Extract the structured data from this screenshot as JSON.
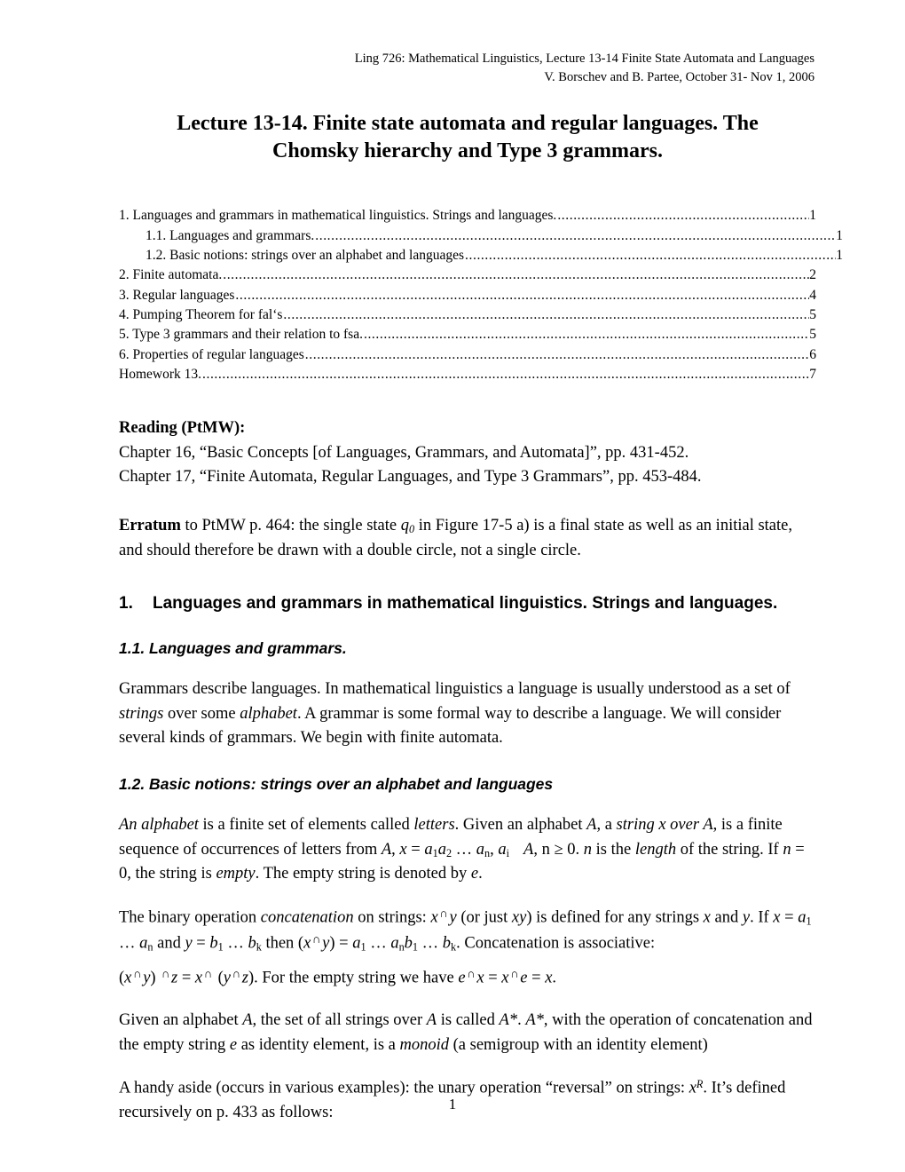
{
  "running_header": {
    "line1": "Ling 726: Mathematical Linguistics, Lecture 13-14 Finite State Automata and Languages",
    "line2": "V. Borschev and B. Partee, October 31- Nov 1, 2006"
  },
  "doc_title": {
    "line1": "Lecture 13-14. Finite state automata and regular languages. The Chomsky",
    "line2": "hierarchy and Type 3 grammars."
  },
  "toc": {
    "entries": [
      {
        "level": 1,
        "label": "1.  Languages and grammars in mathematical linguistics. Strings and languages.",
        "page": "1"
      },
      {
        "level": 2,
        "label": "1.1. Languages and grammars.",
        "page": "1"
      },
      {
        "level": 2,
        "label": "1.2. Basic notions: strings over an alphabet and languages",
        "page": "1"
      },
      {
        "level": 1,
        "label": "2.  Finite automata.",
        "page": "2"
      },
      {
        "level": 1,
        "label": "3.  Regular languages",
        "page": "4"
      },
      {
        "level": 1,
        "label": "4. Pumping Theorem for fal‘s",
        "page": "5"
      },
      {
        "level": 1,
        "label": "5.  Type 3 grammars and their relation to fsa.",
        "page": "5"
      },
      {
        "level": 1,
        "label": "6. Properties of regular languages",
        "page": "6"
      },
      {
        "level": 1,
        "label": "Homework 13.",
        "page": "7"
      }
    ]
  },
  "reading": {
    "heading": "Reading (PtMW):",
    "chapter16": "Chapter 16, “Basic Concepts [of Languages, Grammars, and Automata]”, pp. 431-452.",
    "chapter17": "Chapter 17, “Finite Automata, Regular Languages, and Type 3 Grammars”, pp. 453-484."
  },
  "erratum": {
    "lead": "Erratum",
    "text_before_q": " to PtMW p. 464: the single state ",
    "state_symbol": "q",
    "state_subscript": "0",
    "text_after_q": " in Figure 17-5 a) is a final state as well as an initial state, and should therefore be drawn with a double circle, not a single circle."
  },
  "section1": {
    "number": "1.",
    "heading": "Languages and grammars in mathematical linguistics. Strings and languages.",
    "sub1": {
      "heading": "1.1. Languages and grammars.",
      "paragraph_a": "Grammars describe languages. In mathematical linguistics a language is usually understood as a set of ",
      "italic_strings": "strings",
      "paragraph_b": " over some ",
      "italic_alphabet": "alphabet",
      "paragraph_c": ". A grammar is some formal way to describe a language. We will consider several kinds of grammars. We begin with finite automata."
    },
    "sub2": {
      "heading": "1.2. Basic notions: strings over an alphabet and languages",
      "p_alphabet": {
        "it_an_alphabet": "An alphabet",
        "t1": " is a finite set of elements called ",
        "it_letters": "letters",
        "t2": ". Given an alphabet ",
        "it_A": "A",
        "t3": ", a ",
        "it_string_x_over_A": "string x over A",
        "t4": ", is a finite sequence of occurrences of letters from ",
        "it_A2": "A",
        "t5": ", ",
        "it_x": "x",
        "t6": " = ",
        "it_a": "a",
        "sub1": "1",
        "it_a2": "a",
        "sub2": "2",
        "t7": " … ",
        "it_a3": "a",
        "subn": "n",
        "t8": ", ",
        "it_a4": "a",
        "subi": "i",
        "t9": "   ",
        "it_A3": "A",
        "t10": ", n ≥ 0. ",
        "it_n": "n",
        "t11": " is the ",
        "it_length": "length",
        "t12": " of the string. If ",
        "it_n2": "n",
        "t13": " = 0, the string is ",
        "it_empty": "empty",
        "t14": ". The empty string is denoted by ",
        "it_e": "e",
        "t15": "."
      },
      "p_concat": {
        "t1": "The binary operation ",
        "it_concatenation": "concatenation",
        "t2": " on strings: ",
        "it_x": "x",
        "op1": "∩",
        "it_y": "y",
        "t3": " (or just ",
        "it_xy": "xy",
        "t4": ") is defined for any strings ",
        "it_x2": "x",
        "t5": " and ",
        "it_y2": "y",
        "t6": ". If   ",
        "it_x3": "x",
        "t7": " = ",
        "it_a": "a",
        "sub1": "1",
        "t8": " … ",
        "it_a2": "a",
        "subn": "n",
        "t9": " and ",
        "it_y3": "y",
        "t10": " = ",
        "it_b": "b",
        "sub1b": "1",
        "t11": " … ",
        "it_b2": "b",
        "subk": "k",
        "t12": " then (",
        "it_x4": "x",
        "op2": "∩",
        "it_y4": "y",
        "t13": ") = ",
        "it_a3": "a",
        "sub1c": "1",
        "t14": " … ",
        "it_a4": "a",
        "subn2": "n",
        "it_b3": "b",
        "sub1d": "1",
        "t15": " … ",
        "it_b4": "b",
        "subk2": "k",
        "t16": ". Concatenation is associative:"
      },
      "p_assoc": {
        "t1": "(",
        "it_x": "x",
        "op1": "∩",
        "it_y": "y",
        "t2": ") ",
        "op2": "∩",
        "it_z": "z",
        "t3": "  =  ",
        "it_x2": "x",
        "op3": "∩",
        "t4": " (",
        "it_y2": "y",
        "op4": "∩",
        "it_z2": "z",
        "t5": "). For the empty string we have  ",
        "it_e": "e",
        "op5": "∩",
        "it_x3": "x",
        "t6": " = ",
        "it_x4": "x",
        "op6": "∩",
        "it_e2": "e",
        "t7": "  = ",
        "it_x5": "x",
        "t8": "."
      },
      "p_monoid": {
        "t1": "Given an alphabet ",
        "it_A": "A",
        "t2": ", the set of all strings over ",
        "it_A2": "A",
        "t3": " is called ",
        "it_Astar": "A*",
        "t4": ". ",
        "it_Astar2": "A*",
        "t5": ", with the operation of concatenation and the empty string ",
        "it_e": "e",
        "t6": " as identity element, is a ",
        "it_monoid": "monoid",
        "t7": " (a semigroup with an identity element)"
      },
      "p_reversal": {
        "t1": "A handy aside (occurs in various examples): the unary operation “reversal” on strings: ",
        "it_x": "x",
        "sup_R": "R",
        "t2": ". It’s defined recursively on p. 433 as follows:"
      }
    }
  },
  "footer": {
    "page_number": "1"
  }
}
